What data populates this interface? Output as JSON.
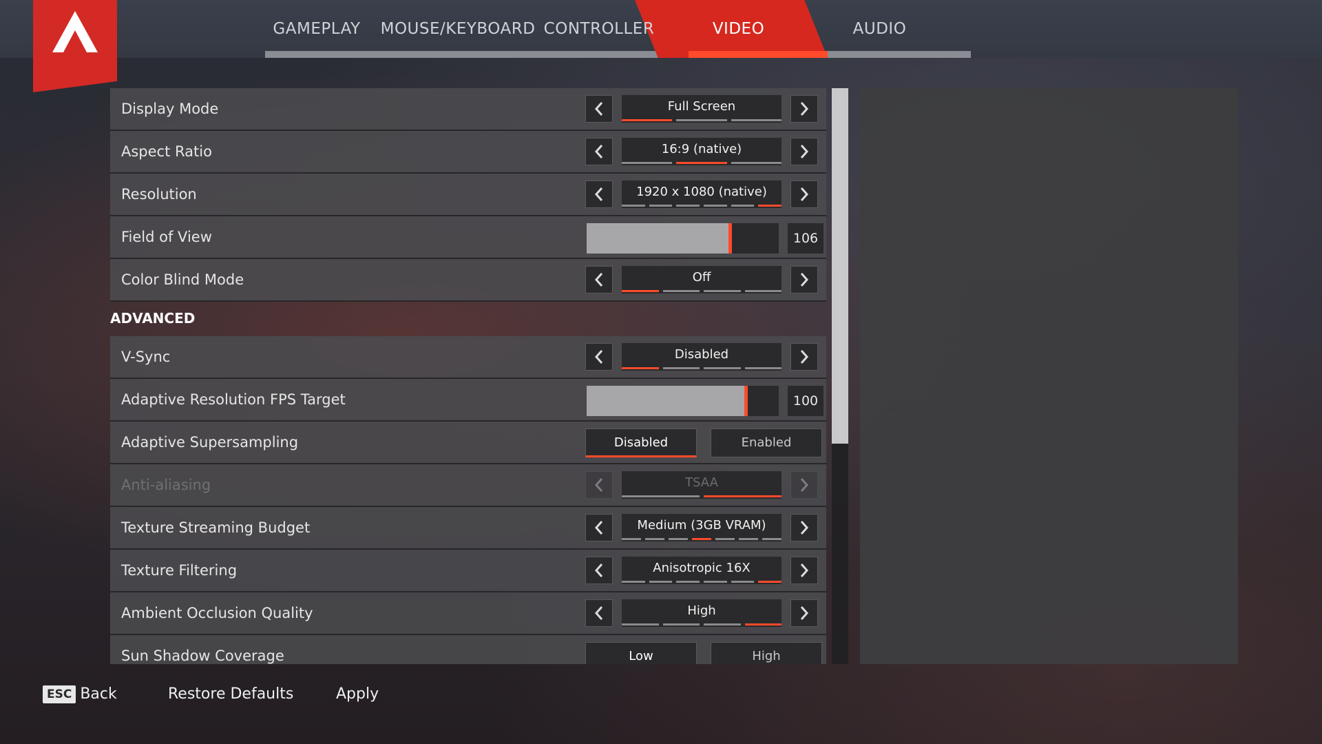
{
  "tabs": [
    {
      "label": "GAMEPLAY",
      "active": false
    },
    {
      "label": "MOUSE/KEYBOARD",
      "active": false
    },
    {
      "label": "CONTROLLER",
      "active": false
    },
    {
      "label": "VIDEO",
      "active": true
    },
    {
      "label": "AUDIO",
      "active": false
    }
  ],
  "settings": {
    "display_mode": {
      "label": "Display Mode",
      "value": "Full Screen",
      "options": 3,
      "selected": 0
    },
    "aspect_ratio": {
      "label": "Aspect Ratio",
      "value": "16:9 (native)",
      "options": 3,
      "selected": 1
    },
    "resolution": {
      "label": "Resolution",
      "value": "1920 x 1080 (native)",
      "options": 6,
      "selected": 5
    },
    "field_of_view": {
      "label": "Field of View",
      "value": "106",
      "fill_fraction": 0.74
    },
    "color_blind_mode": {
      "label": "Color Blind Mode",
      "value": "Off",
      "options": 4,
      "selected": 0
    },
    "advanced_header": "ADVANCED",
    "vsync": {
      "label": "V-Sync",
      "value": "Disabled",
      "options": 4,
      "selected": 0
    },
    "adaptive_res_fps": {
      "label": "Adaptive Resolution FPS Target",
      "value": "100",
      "fill_fraction": 0.82
    },
    "adaptive_supersampling": {
      "label": "Adaptive Supersampling",
      "option_a": "Disabled",
      "option_b": "Enabled",
      "selected": "option_a"
    },
    "anti_aliasing": {
      "label": "Anti-aliasing",
      "value": "TSAA",
      "options": 2,
      "selected": 1,
      "disabled": true
    },
    "texture_streaming": {
      "label": "Texture Streaming Budget",
      "value": "Medium (3GB VRAM)",
      "options": 7,
      "selected": 3
    },
    "texture_filtering": {
      "label": "Texture Filtering",
      "value": "Anisotropic 16X",
      "options": 6,
      "selected": 5
    },
    "ambient_occlusion": {
      "label": "Ambient Occlusion Quality",
      "value": "High",
      "options": 4,
      "selected": 3
    },
    "sun_shadow": {
      "label": "Sun Shadow Coverage",
      "option_a": "Low",
      "option_b": "High"
    }
  },
  "footer": {
    "esc_key": "ESC",
    "back": "Back",
    "restore": "Restore Defaults",
    "apply": "Apply"
  },
  "colors": {
    "accent": "#ff4a2b",
    "brand_red": "#d32a25"
  }
}
